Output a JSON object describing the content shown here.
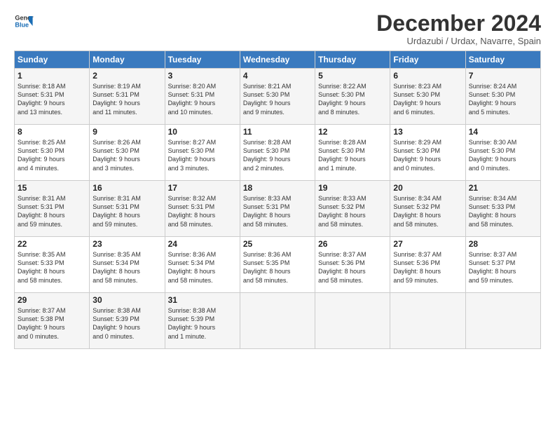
{
  "header": {
    "logo_line1": "General",
    "logo_line2": "Blue",
    "title": "December 2024",
    "subtitle": "Urdazubi / Urdax, Navarre, Spain"
  },
  "days_of_week": [
    "Sunday",
    "Monday",
    "Tuesday",
    "Wednesday",
    "Thursday",
    "Friday",
    "Saturday"
  ],
  "weeks": [
    [
      {
        "day": "1",
        "info": "Sunrise: 8:18 AM\nSunset: 5:31 PM\nDaylight: 9 hours\nand 13 minutes."
      },
      {
        "day": "2",
        "info": "Sunrise: 8:19 AM\nSunset: 5:31 PM\nDaylight: 9 hours\nand 11 minutes."
      },
      {
        "day": "3",
        "info": "Sunrise: 8:20 AM\nSunset: 5:31 PM\nDaylight: 9 hours\nand 10 minutes."
      },
      {
        "day": "4",
        "info": "Sunrise: 8:21 AM\nSunset: 5:30 PM\nDaylight: 9 hours\nand 9 minutes."
      },
      {
        "day": "5",
        "info": "Sunrise: 8:22 AM\nSunset: 5:30 PM\nDaylight: 9 hours\nand 8 minutes."
      },
      {
        "day": "6",
        "info": "Sunrise: 8:23 AM\nSunset: 5:30 PM\nDaylight: 9 hours\nand 6 minutes."
      },
      {
        "day": "7",
        "info": "Sunrise: 8:24 AM\nSunset: 5:30 PM\nDaylight: 9 hours\nand 5 minutes."
      }
    ],
    [
      {
        "day": "8",
        "info": "Sunrise: 8:25 AM\nSunset: 5:30 PM\nDaylight: 9 hours\nand 4 minutes."
      },
      {
        "day": "9",
        "info": "Sunrise: 8:26 AM\nSunset: 5:30 PM\nDaylight: 9 hours\nand 3 minutes."
      },
      {
        "day": "10",
        "info": "Sunrise: 8:27 AM\nSunset: 5:30 PM\nDaylight: 9 hours\nand 3 minutes."
      },
      {
        "day": "11",
        "info": "Sunrise: 8:28 AM\nSunset: 5:30 PM\nDaylight: 9 hours\nand 2 minutes."
      },
      {
        "day": "12",
        "info": "Sunrise: 8:28 AM\nSunset: 5:30 PM\nDaylight: 9 hours\nand 1 minute."
      },
      {
        "day": "13",
        "info": "Sunrise: 8:29 AM\nSunset: 5:30 PM\nDaylight: 9 hours\nand 0 minutes."
      },
      {
        "day": "14",
        "info": "Sunrise: 8:30 AM\nSunset: 5:30 PM\nDaylight: 9 hours\nand 0 minutes."
      }
    ],
    [
      {
        "day": "15",
        "info": "Sunrise: 8:31 AM\nSunset: 5:31 PM\nDaylight: 8 hours\nand 59 minutes."
      },
      {
        "day": "16",
        "info": "Sunrise: 8:31 AM\nSunset: 5:31 PM\nDaylight: 8 hours\nand 59 minutes."
      },
      {
        "day": "17",
        "info": "Sunrise: 8:32 AM\nSunset: 5:31 PM\nDaylight: 8 hours\nand 58 minutes."
      },
      {
        "day": "18",
        "info": "Sunrise: 8:33 AM\nSunset: 5:31 PM\nDaylight: 8 hours\nand 58 minutes."
      },
      {
        "day": "19",
        "info": "Sunrise: 8:33 AM\nSunset: 5:32 PM\nDaylight: 8 hours\nand 58 minutes."
      },
      {
        "day": "20",
        "info": "Sunrise: 8:34 AM\nSunset: 5:32 PM\nDaylight: 8 hours\nand 58 minutes."
      },
      {
        "day": "21",
        "info": "Sunrise: 8:34 AM\nSunset: 5:33 PM\nDaylight: 8 hours\nand 58 minutes."
      }
    ],
    [
      {
        "day": "22",
        "info": "Sunrise: 8:35 AM\nSunset: 5:33 PM\nDaylight: 8 hours\nand 58 minutes."
      },
      {
        "day": "23",
        "info": "Sunrise: 8:35 AM\nSunset: 5:34 PM\nDaylight: 8 hours\nand 58 minutes."
      },
      {
        "day": "24",
        "info": "Sunrise: 8:36 AM\nSunset: 5:34 PM\nDaylight: 8 hours\nand 58 minutes."
      },
      {
        "day": "25",
        "info": "Sunrise: 8:36 AM\nSunset: 5:35 PM\nDaylight: 8 hours\nand 58 minutes."
      },
      {
        "day": "26",
        "info": "Sunrise: 8:37 AM\nSunset: 5:36 PM\nDaylight: 8 hours\nand 58 minutes."
      },
      {
        "day": "27",
        "info": "Sunrise: 8:37 AM\nSunset: 5:36 PM\nDaylight: 8 hours\nand 59 minutes."
      },
      {
        "day": "28",
        "info": "Sunrise: 8:37 AM\nSunset: 5:37 PM\nDaylight: 8 hours\nand 59 minutes."
      }
    ],
    [
      {
        "day": "29",
        "info": "Sunrise: 8:37 AM\nSunset: 5:38 PM\nDaylight: 9 hours\nand 0 minutes."
      },
      {
        "day": "30",
        "info": "Sunrise: 8:38 AM\nSunset: 5:39 PM\nDaylight: 9 hours\nand 0 minutes."
      },
      {
        "day": "31",
        "info": "Sunrise: 8:38 AM\nSunset: 5:39 PM\nDaylight: 9 hours\nand 1 minute."
      },
      {
        "day": "",
        "info": ""
      },
      {
        "day": "",
        "info": ""
      },
      {
        "day": "",
        "info": ""
      },
      {
        "day": "",
        "info": ""
      }
    ]
  ]
}
